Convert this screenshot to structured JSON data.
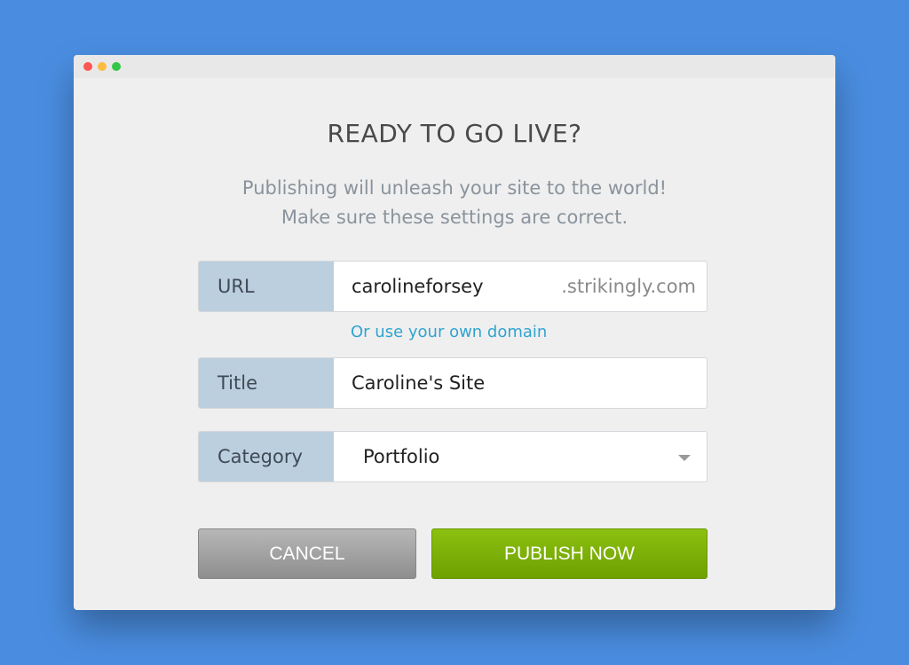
{
  "window": {
    "controls": [
      {
        "name": "close",
        "color": "#fc5753"
      },
      {
        "name": "minimize",
        "color": "#fdbc40"
      },
      {
        "name": "zoom",
        "color": "#33c748"
      }
    ]
  },
  "dialog": {
    "title": "READY TO GO LIVE?",
    "subtitle_line1": "Publishing will unleash your site to the world!",
    "subtitle_line2": "Make sure these settings are correct.",
    "url": {
      "label": "URL",
      "value": "carolineforsey",
      "suffix": ".strikingly.com"
    },
    "own_domain_link": "Or use your own domain",
    "site_title": {
      "label": "Title",
      "value": "Caroline's Site"
    },
    "category": {
      "label": "Category",
      "value": "Portfolio"
    },
    "cancel_label": "CANCEL",
    "publish_label": "PUBLISH NOW"
  },
  "colors": {
    "background": "#4a8de0",
    "accent_link": "#2fa4d0",
    "publish": "#7cb305"
  }
}
